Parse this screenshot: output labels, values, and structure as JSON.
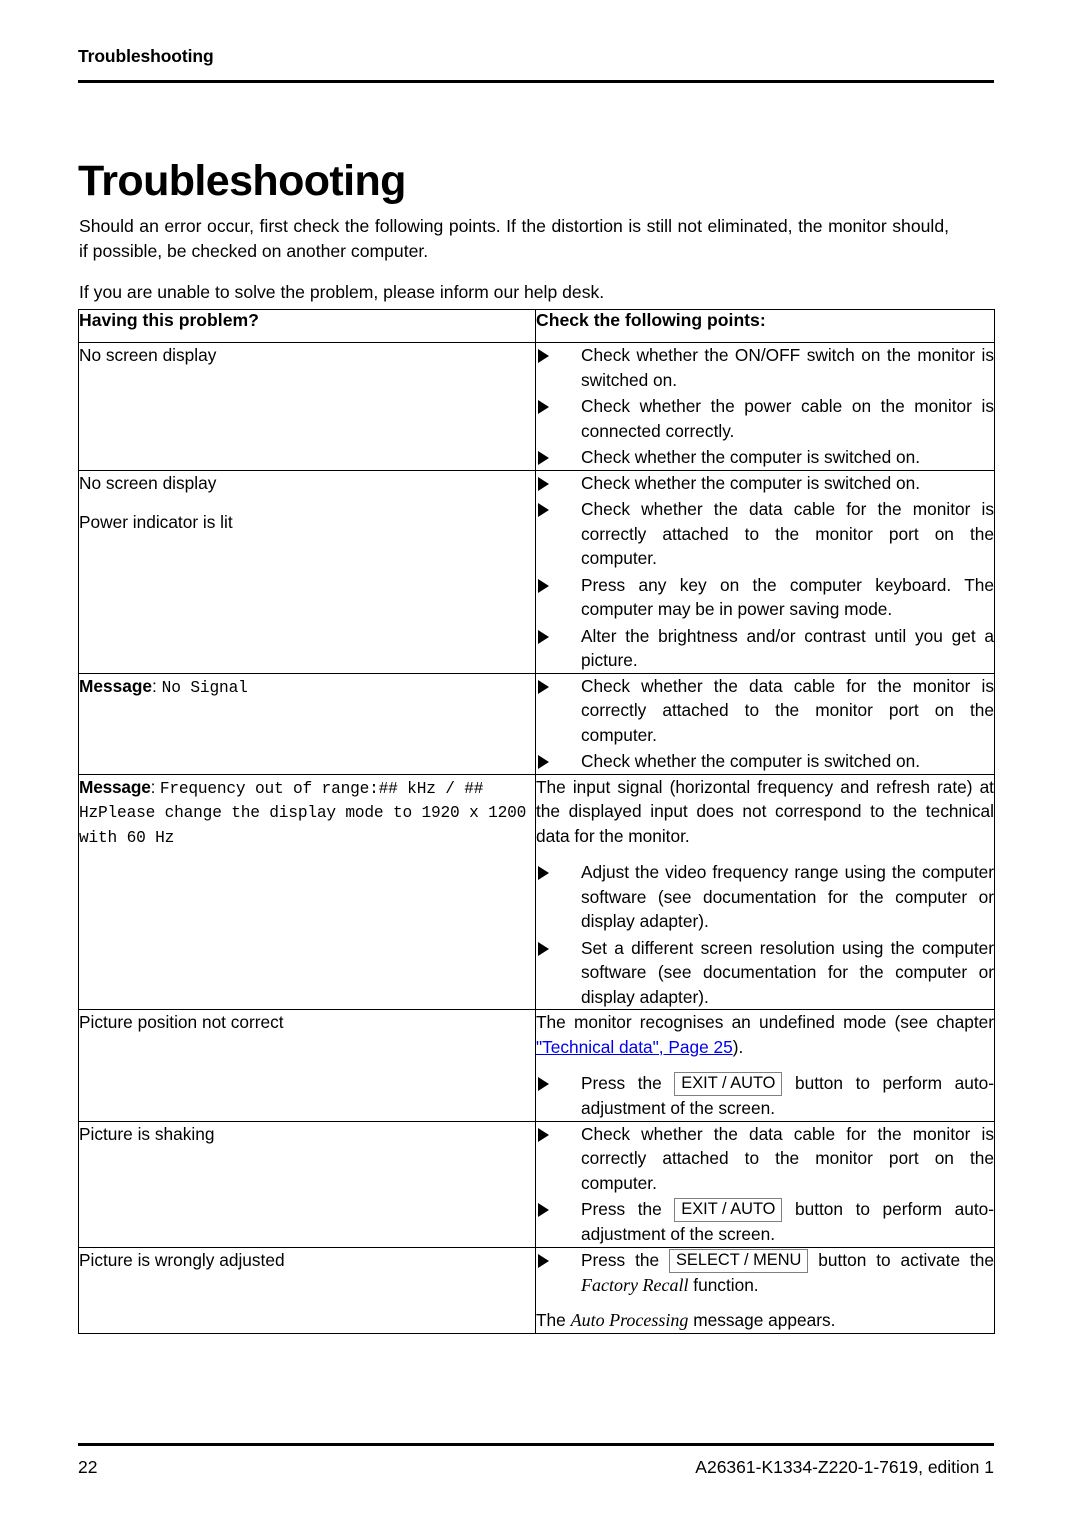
{
  "header": {
    "running_title": "Troubleshooting"
  },
  "chapter": {
    "title": "Troubleshooting"
  },
  "intro": {
    "paragraph_1": "Should an error occur, first check the following points. If the distortion is still not eliminated, the monitor should, if possible, be checked on another computer.",
    "paragraph_2": "If you are unable to solve the problem, please inform our help desk."
  },
  "table": {
    "columns": {
      "problem": "Having this problem?",
      "check": "Check the following points:"
    },
    "rows": [
      {
        "problem_lines": [
          "No screen display"
        ],
        "bullets": [
          "Check whether the ON/OFF switch on the monitor is switched on.",
          "Check whether the power cable on the monitor is connected correctly.",
          "Check whether the computer is switched on."
        ]
      },
      {
        "problem_lines": [
          "No screen display",
          "Power indicator is lit"
        ],
        "bullets": [
          "Check whether the computer is switched on.",
          "Check whether the data cable for the monitor is correctly attached to the monitor port on the computer.",
          "Press any key on the computer keyboard. The computer may be in power saving mode.",
          "Alter the brightness and/or contrast until you get a picture."
        ]
      },
      {
        "message_label": "Message",
        "message_value": "No Signal",
        "bullets": [
          "Check whether the data cable for the monitor is correctly attached to the monitor port on the computer.",
          "Check whether the computer is switched on."
        ]
      },
      {
        "message_label": "Message",
        "message_value": "Frequency out of range:## kHz / ## HzPlease change the display mode to 1920 x 1200 with 60 Hz",
        "lead_paragraph": "The input signal (horizontal frequency and refresh rate) at the displayed input does not correspond to the technical data for the monitor.",
        "bullets": [
          "Adjust the video frequency range using the computer software (see documentation for the computer or display adapter).",
          "Set a different screen resolution using the computer software (see documentation for the computer or display adapter)."
        ]
      },
      {
        "problem_lines": [
          "Picture position not correct"
        ],
        "lead_paragraph_parts": {
          "before_link": "The monitor recognises an undefined mode (see chapter ",
          "link": "\"Technical data\", Page 25",
          "after_link": ")."
        },
        "bullets_with_key": [
          {
            "before": "Press the",
            "key": "EXIT / AUTO",
            "after": "button to perform auto-adjustment of the screen."
          }
        ]
      },
      {
        "problem_lines": [
          "Picture is shaking"
        ],
        "bullets": [
          "Check whether the data cable for the monitor is correctly attached to the monitor port on the computer."
        ],
        "bullets_with_key": [
          {
            "before": "Press the",
            "key": "EXIT / AUTO",
            "after": "button to perform auto-adjustment of the screen."
          }
        ]
      },
      {
        "problem_lines": [
          "Picture is wrongly adjusted"
        ],
        "bullets_with_key": [
          {
            "before": "Press the",
            "key": "SELECT / MENU",
            "after_before_italic": "button to activate the",
            "italic": "Factory Recall",
            "after_italic": "function."
          }
        ],
        "trailing_paragraph": {
          "before_italic": "The",
          "italic": "Auto Processing",
          "after_italic": "message appears."
        }
      }
    ]
  },
  "footer": {
    "page_number": "22",
    "document_id": "A26361-K1334-Z220-1-7619, edition 1"
  },
  "colors": {
    "link": "#0000ee",
    "rule": "#000000",
    "keycap_border": "#808080"
  }
}
